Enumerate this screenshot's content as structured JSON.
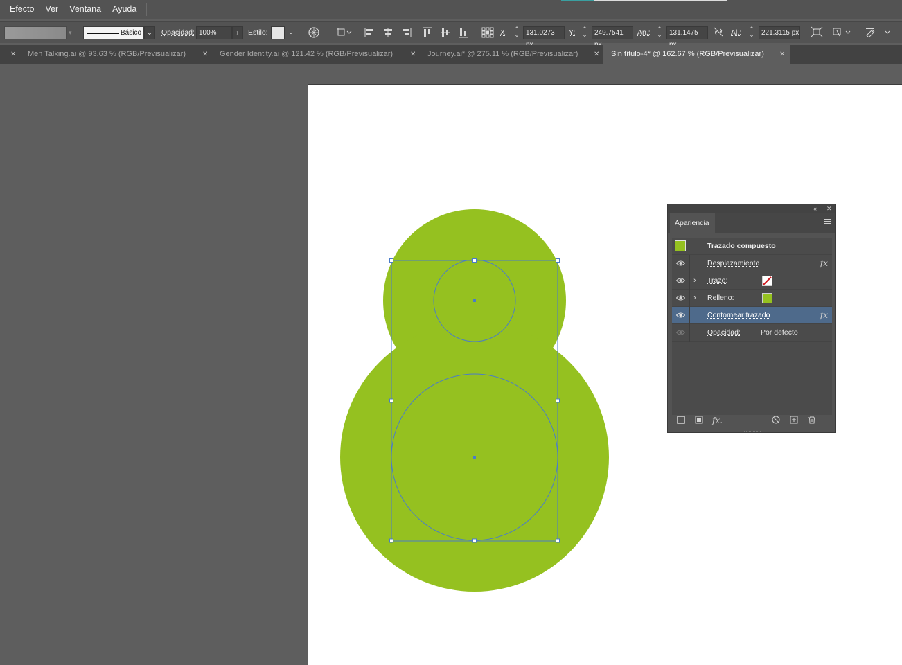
{
  "menubar": {
    "items": [
      "Efecto",
      "Ver",
      "Ventana",
      "Ayuda"
    ]
  },
  "controlbar": {
    "stroke_profile_label": "Básico",
    "opacity_label": "Opacidad:",
    "opacity_value": "100%",
    "style_label": "Estilo:",
    "x_label": "X:",
    "x_value": "131.0273 px",
    "y_label": "Y:",
    "y_value": "249.7541 px",
    "width_label": "An.:",
    "width_value": "131.1475 px",
    "height_label": "Al.:",
    "height_value": "221.3115 px"
  },
  "tabs": [
    {
      "label": "Men Talking.ai @ 93.63 % (RGB/Previsualizar)",
      "active": false
    },
    {
      "label": "Gender Identity.ai @ 121.42 % (RGB/Previsualizar)",
      "active": false
    },
    {
      "label": "Journey.ai* @ 275.11 % (RGB/Previsualizar)",
      "active": false
    },
    {
      "label": "Sin título-4* @ 162.67 % (RGB/Previsualizar)",
      "active": true
    }
  ],
  "artwork": {
    "fill_color": "#95c120",
    "selection_color": "#4a7cc9"
  },
  "appearance_panel": {
    "tab_label": "Apariencia",
    "header": "Trazado compuesto",
    "rows": [
      {
        "name": "Desplazamiento",
        "has_fx": true
      },
      {
        "name": "Trazo:",
        "twisty": true,
        "swatch": "none"
      },
      {
        "name": "Relleno:",
        "twisty": true,
        "swatch": "#95c120"
      },
      {
        "name": "Contornear trazado",
        "has_fx": true,
        "selected": true
      },
      {
        "name": "Opacidad:",
        "value": "Por defecto"
      }
    ],
    "fx_symbol": "fx",
    "footer_fx_label": "fx."
  },
  "icons": {
    "close": "✕",
    "chevron_down": "⌄",
    "chevron_right": "›",
    "collapse": "«"
  }
}
